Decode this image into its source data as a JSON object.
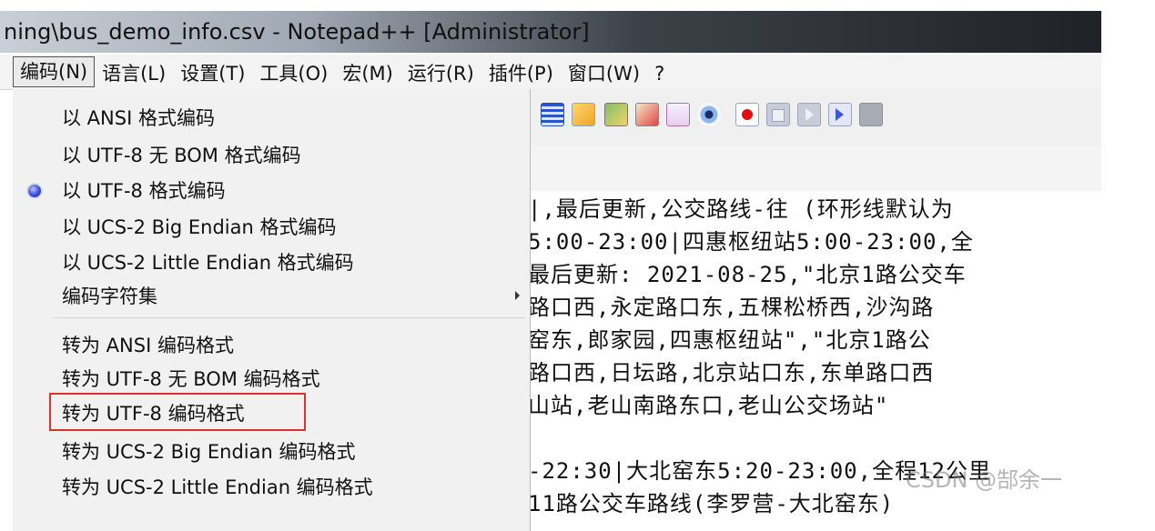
{
  "window": {
    "title": "ning\\bus_demo_info.csv - Notepad++ [Administrator]"
  },
  "menubar": {
    "items": [
      {
        "label": "编码(N)",
        "active": true
      },
      {
        "label": "语言(L)"
      },
      {
        "label": "设置(T)"
      },
      {
        "label": "工具(O)"
      },
      {
        "label": "宏(M)"
      },
      {
        "label": "运行(R)"
      },
      {
        "label": "插件(P)"
      },
      {
        "label": "窗口(W)"
      },
      {
        "label": "?"
      }
    ]
  },
  "encoding_menu": {
    "group1": [
      "以 ANSI 格式编码",
      "以 UTF-8 无 BOM 格式编码",
      "以 UTF-8 格式编码",
      "以 UCS-2 Big Endian 格式编码",
      "以 UCS-2 Little Endian 格式编码",
      "编码字符集"
    ],
    "selected": "以 UTF-8 格式编码",
    "group2": [
      "转为 ANSI 编码格式",
      "转为 UTF-8 无 BOM 编码格式",
      "转为 UTF-8 编码格式",
      "转为 UCS-2 Big Endian 编码格式",
      "转为 UCS-2 Little Endian 编码格式"
    ],
    "highlighted": "转为 UTF-8 编码格式"
  },
  "editor": {
    "lines": [
      "|,最后更新,公交路线-往 (环形线默认为",
      "5:00-23:00|四惠枢纽站5:00-23:00,全",
      "最后更新: 2021-08-25,\"北京1路公交车",
      "路口西,永定路口东,五棵松桥西,沙沟路",
      "窑东,郎家园,四惠枢纽站\",\"北京1路公",
      "路口西,日坛路,北京站口东,东单路口西",
      "山站,老山南路东口,老山公交场站\"",
      "",
      "-22:30|大北窑东5:20-23:00,全程12公里",
      "11路公交车路线(李罗营-大北窑东)"
    ]
  },
  "watermark": "CSDN @郜余一",
  "colors": {
    "highlight_border": "#e03030",
    "radio": "#3a4ad6",
    "record": "#e01010"
  }
}
